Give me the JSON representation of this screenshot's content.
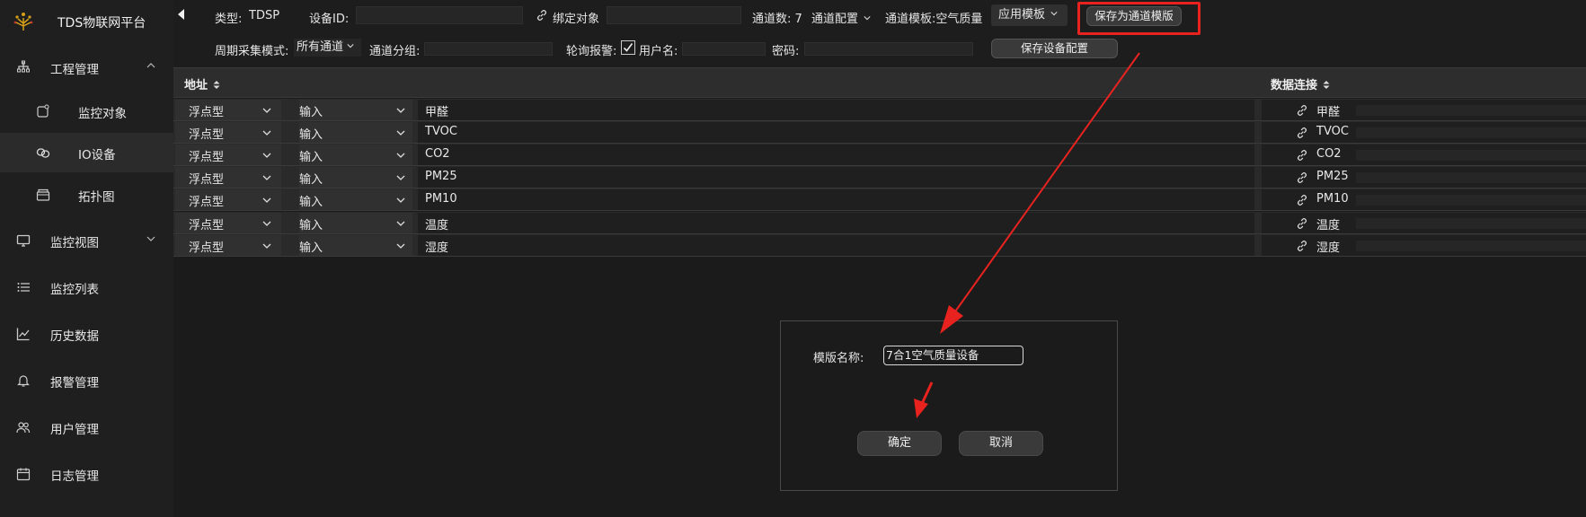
{
  "app": {
    "title": "TDS物联网平台"
  },
  "sidebar": {
    "items": [
      {
        "label": "工程管理",
        "icon": "sitemap-icon"
      },
      {
        "label": "监控对象",
        "icon": "monitor-object-icon"
      },
      {
        "label": "IO设备",
        "icon": "link-device-icon"
      },
      {
        "label": "拓扑图",
        "icon": "topology-icon"
      },
      {
        "label": "监控视图",
        "icon": "desktop-icon"
      },
      {
        "label": "监控列表",
        "icon": "list-icon"
      },
      {
        "label": "历史数据",
        "icon": "chart-line-icon"
      },
      {
        "label": "报警管理",
        "icon": "bell-icon"
      },
      {
        "label": "用户管理",
        "icon": "users-icon"
      },
      {
        "label": "日志管理",
        "icon": "calendar-icon"
      }
    ]
  },
  "toolbar": {
    "type_label": "类型:",
    "type_value": "TDSP",
    "device_id_label": "设备ID:",
    "device_id_value": "",
    "bind_object_label": "绑定对象",
    "bind_object_value": "",
    "channel_count": "通道数: 7",
    "channel_config": "通道配置",
    "channel_template": "通道模板:空气质量",
    "apply_template": "应用模板",
    "save_as_template": "保存为通道模版",
    "cycle_mode_label": "周期采集模式:",
    "cycle_mode_value": "所有通道",
    "channel_group_label": "通道分组:",
    "channel_group_value": "",
    "poll_alarm_label": "轮询报警:",
    "poll_alarm_checked": true,
    "username_label": "用户名:",
    "username_value": "",
    "password_label": "密码:",
    "password_value": "",
    "save_device_config": "保存设备配置"
  },
  "table": {
    "headers": {
      "address": "地址",
      "data_link": "数据连接"
    },
    "rows": [
      {
        "type": "浮点型",
        "io": "输入",
        "name": "甲醛",
        "link": "甲醛"
      },
      {
        "type": "浮点型",
        "io": "输入",
        "name": "TVOC",
        "link": "TVOC"
      },
      {
        "type": "浮点型",
        "io": "输入",
        "name": "CO2",
        "link": "CO2"
      },
      {
        "type": "浮点型",
        "io": "输入",
        "name": "PM25",
        "link": "PM25"
      },
      {
        "type": "浮点型",
        "io": "输入",
        "name": "PM10",
        "link": "PM10"
      },
      {
        "type": "浮点型",
        "io": "输入",
        "name": "温度",
        "link": "温度"
      },
      {
        "type": "浮点型",
        "io": "输入",
        "name": "湿度",
        "link": "湿度"
      }
    ]
  },
  "dialog": {
    "name_label": "模版名称:",
    "name_value": "7合1空气质量设备",
    "ok_label": "确定",
    "cancel_label": "取消"
  },
  "colors": {
    "background": "#1b1b1b",
    "sidebar": "#1f1f1f",
    "annotation_red": "#e8231f",
    "logo_gold": "#d4a017"
  }
}
